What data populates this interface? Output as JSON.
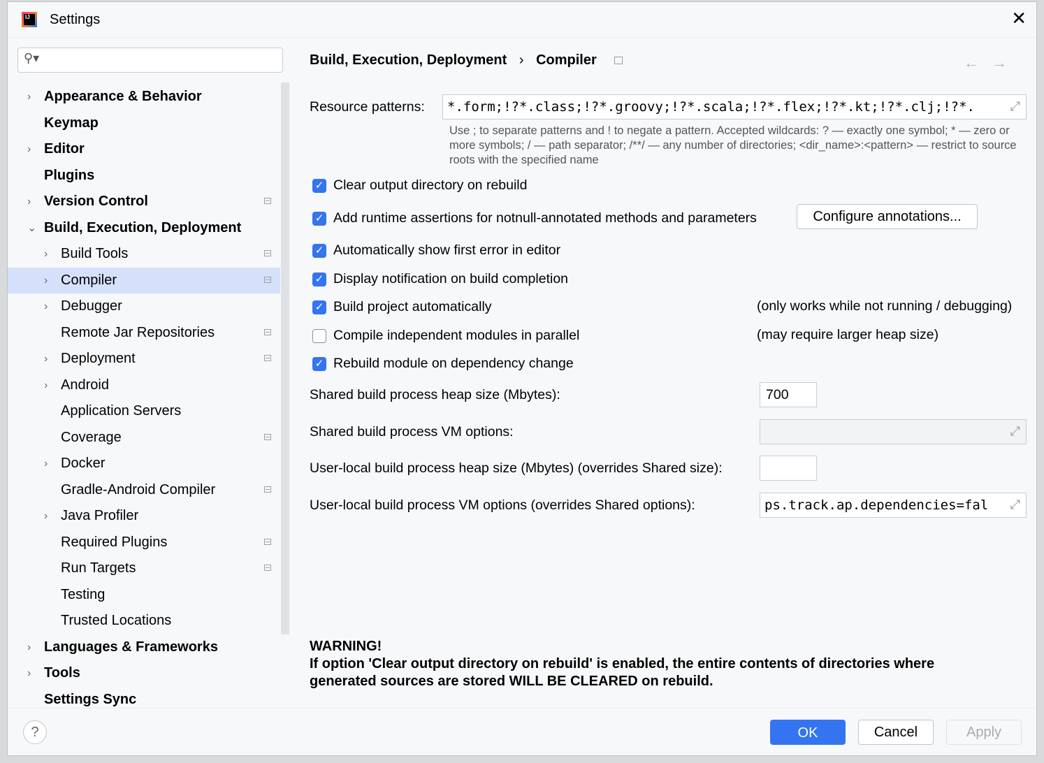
{
  "window": {
    "title": "Settings",
    "close": "✕"
  },
  "search": {
    "placeholder": "",
    "icon": "search-icon"
  },
  "sidebar": {
    "items": [
      {
        "label": "Appearance & Behavior",
        "level": 0,
        "chevron": "›",
        "bold": true,
        "proj": false
      },
      {
        "label": "Keymap",
        "level": 0,
        "chevron": "",
        "bold": true,
        "proj": false
      },
      {
        "label": "Editor",
        "level": 0,
        "chevron": "›",
        "bold": true,
        "proj": false
      },
      {
        "label": "Plugins",
        "level": 0,
        "chevron": "",
        "bold": true,
        "proj": false
      },
      {
        "label": "Version Control",
        "level": 0,
        "chevron": "›",
        "bold": true,
        "proj": true
      },
      {
        "label": "Build, Execution, Deployment",
        "level": 0,
        "chevron": "⌄",
        "bold": true,
        "proj": false
      },
      {
        "label": "Build Tools",
        "level": 1,
        "chevron": "›",
        "proj": true
      },
      {
        "label": "Compiler",
        "level": 1,
        "chevron": "›",
        "proj": true,
        "selected": true
      },
      {
        "label": "Debugger",
        "level": 1,
        "chevron": "›",
        "proj": false
      },
      {
        "label": "Remote Jar Repositories",
        "level": 1,
        "chevron": "",
        "proj": true
      },
      {
        "label": "Deployment",
        "level": 1,
        "chevron": "›",
        "proj": true
      },
      {
        "label": "Android",
        "level": 1,
        "chevron": "›",
        "proj": false
      },
      {
        "label": "Application Servers",
        "level": 1,
        "chevron": "",
        "proj": false
      },
      {
        "label": "Coverage",
        "level": 1,
        "chevron": "",
        "proj": true
      },
      {
        "label": "Docker",
        "level": 1,
        "chevron": "›",
        "proj": false
      },
      {
        "label": "Gradle-Android Compiler",
        "level": 1,
        "chevron": "",
        "proj": true
      },
      {
        "label": "Java Profiler",
        "level": 1,
        "chevron": "›",
        "proj": false
      },
      {
        "label": "Required Plugins",
        "level": 1,
        "chevron": "",
        "proj": true
      },
      {
        "label": "Run Targets",
        "level": 1,
        "chevron": "",
        "proj": true
      },
      {
        "label": "Testing",
        "level": 1,
        "chevron": "",
        "proj": false
      },
      {
        "label": "Trusted Locations",
        "level": 1,
        "chevron": "",
        "proj": false
      },
      {
        "label": "Languages & Frameworks",
        "level": 0,
        "chevron": "›",
        "bold": true,
        "proj": false
      },
      {
        "label": "Tools",
        "level": 0,
        "chevron": "›",
        "bold": true,
        "proj": false
      },
      {
        "label": "Settings Sync",
        "level": 0,
        "chevron": "",
        "bold": true,
        "proj": false
      }
    ]
  },
  "breadcrumb": {
    "parent": "Build, Execution, Deployment",
    "sep": "›",
    "current": "Compiler",
    "back": "←",
    "forward": "→"
  },
  "resource": {
    "label": "Resource patterns:",
    "value": "*.form;!?*.class;!?*.groovy;!?*.scala;!?*.flex;!?*.kt;!?*.clj;!?*.",
    "help": "Use ; to separate patterns and ! to negate a pattern. Accepted wildcards: ? — exactly one symbol; * — zero or more symbols; / — path separator; /**/ — any number of directories; <dir_name>:<pattern> — restrict to source roots with the specified name"
  },
  "options": [
    {
      "label": "Clear output directory on rebuild",
      "checked": true,
      "note": ""
    },
    {
      "label": "Add runtime assertions for notnull-annotated methods and parameters",
      "checked": true,
      "note": ""
    },
    {
      "label": "Automatically show first error in editor",
      "checked": true,
      "note": ""
    },
    {
      "label": "Display notification on build completion",
      "checked": true,
      "note": ""
    },
    {
      "label": "Build project automatically",
      "checked": true,
      "note": "(only works while not running / debugging)"
    },
    {
      "label": "Compile independent modules in parallel",
      "checked": false,
      "note": "(may require larger heap size)"
    },
    {
      "label": "Rebuild module on dependency change",
      "checked": true,
      "note": ""
    }
  ],
  "configure_button": "Configure annotations...",
  "fields": [
    {
      "label": "Shared build process heap size (Mbytes):",
      "value": "700"
    },
    {
      "label": "Shared build process VM options:",
      "value": ""
    },
    {
      "label": "User-local build process heap size (Mbytes) (overrides Shared size):",
      "value": ""
    },
    {
      "label": "User-local build process VM options (overrides Shared options):",
      "value": "ps.track.ap.dependencies=fal"
    }
  ],
  "warning": {
    "title": "WARNING!",
    "text": "If option 'Clear output directory on rebuild' is enabled, the entire contents of directories where generated sources are stored WILL BE CLEARED on rebuild."
  },
  "footer": {
    "help": "?",
    "ok": "OK",
    "cancel": "Cancel",
    "apply": "Apply"
  },
  "colors": {
    "accent": "#3574f0",
    "selection": "#d5e1fb",
    "background": "#f7f8fa"
  }
}
